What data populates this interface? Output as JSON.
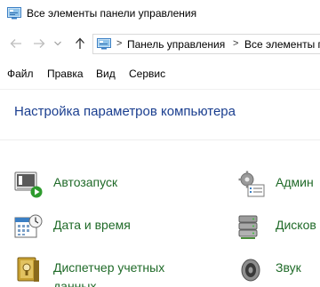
{
  "window": {
    "title": "Все элементы панели управления",
    "icon": "control-panel-icon"
  },
  "navigation": {
    "back": "arrow-left-icon",
    "forward": "arrow-right-icon",
    "recent": "chevron-down-icon",
    "up": "arrow-up-icon"
  },
  "address_bar": {
    "icon": "control-panel-icon",
    "separator": ">",
    "crumbs": [
      "Панель управления",
      "Все элементы п"
    ]
  },
  "menu": {
    "items": [
      "Файл",
      "Правка",
      "Вид",
      "Сервис"
    ]
  },
  "content": {
    "heading": "Настройка параметров компьютера",
    "items": [
      {
        "label": "Автозапуск",
        "icon": "autoplay-icon"
      },
      {
        "label": "Админ",
        "icon": "administrative-tools-icon"
      },
      {
        "label": "Дата и время",
        "icon": "date-time-icon"
      },
      {
        "label": "Дисков",
        "icon": "storage-spaces-icon"
      },
      {
        "label_line1": "Диспетчер учетных",
        "label_line2": "данных",
        "icon": "credential-manager-icon"
      },
      {
        "label": "Звук",
        "icon": "sound-icon"
      }
    ]
  },
  "colors": {
    "link": "#1f6a28",
    "heading": "#1a3e8f"
  }
}
